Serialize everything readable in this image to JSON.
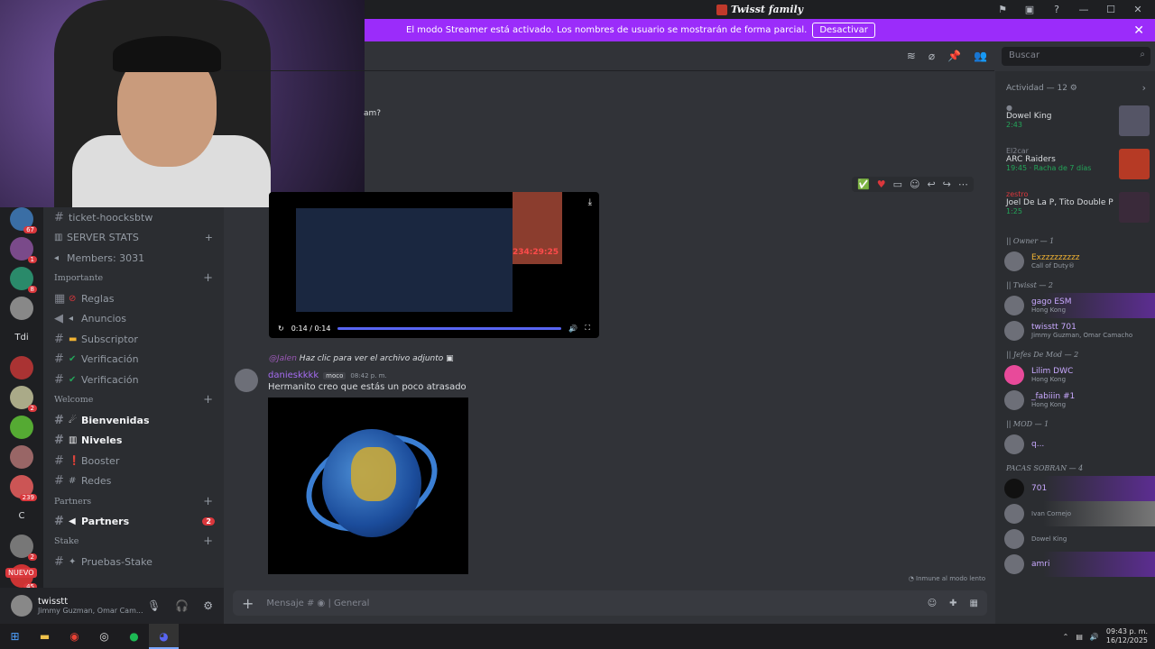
{
  "window": {
    "title": "Twisst family"
  },
  "banner": {
    "text": "El modo Streamer está activado. Los nombres de usuario se mostrarán de forma parcial.",
    "button": "Desactivar"
  },
  "search": {
    "placeholder": "Buscar"
  },
  "server_badges": [
    "67",
    "1",
    "8",
    "",
    "",
    "",
    "2",
    "",
    "",
    "239",
    "",
    "2",
    "45",
    "10"
  ],
  "server_letters": {
    "tdi": "Tdi",
    "c": "C"
  },
  "nuevo": "NUEVO",
  "channels": {
    "top": "ticket-hoocksbtw",
    "server_stats": {
      "title": "SERVER STATS",
      "members": "Members: 3031"
    },
    "importante": {
      "title": "Importante",
      "items": [
        "Reglas",
        "Anuncios",
        "Subscriptor",
        "Verificación",
        "Verificación"
      ]
    },
    "welcome": {
      "title": "Welcome",
      "items": [
        "Bienvenidas",
        "Niveles",
        "Booster",
        "Redes"
      ]
    },
    "partners": {
      "title": "Partners",
      "item": "Partners",
      "badge": "2"
    },
    "stake": {
      "title": "Stake",
      "item": "Pruebas-Stake"
    }
  },
  "user_panel": {
    "name": "twisstt",
    "status": "Jimmy Guzman, Omar Cam..."
  },
  "chat": {
    "video_time": "0:14 / 0:14",
    "video_overlay": "234:29:25",
    "clipped_text": "am?",
    "reply": {
      "name": "@Jalen",
      "text": "Haz clic para ver el archivo adjunto"
    },
    "message": {
      "user": "danieskkkk",
      "tag": "moco",
      "time": "08:42 p. m.",
      "text": "Hermanito creo que estás un poco atrasado"
    },
    "slow_mode": "Inmune al modo lento"
  },
  "composer": {
    "placeholder": "Mensaje #",
    "channel": "General"
  },
  "members": {
    "activity_header": "Actividad — 12",
    "activities": [
      {
        "name": "Dowel King",
        "sub": "2:43"
      },
      {
        "pre": "El2car",
        "name": "ARC Raiders",
        "sub": "19:45 · Racha de 7 días"
      },
      {
        "pre": "zestro",
        "name": "Joel De La P, Tito Double P",
        "sub": "1:25"
      }
    ],
    "groups": [
      {
        "role": "|| Owner — 1",
        "members": [
          {
            "n": "Exzzzzzzzzz",
            "s": "Call of Duty®"
          }
        ]
      },
      {
        "role": "|| Twisst — 2",
        "members": [
          {
            "n": "gago  ESM",
            "s": "Hong Kong"
          },
          {
            "n": "twisstt  701",
            "s": "Jimmy Guzman, Omar Camacho"
          }
        ]
      },
      {
        "role": "|| Jefes De Mod — 2",
        "members": [
          {
            "n": "Lilim  DWC",
            "s": "Hong Kong"
          },
          {
            "n": "_fabiiin  #1",
            "s": "Hong Kong"
          }
        ]
      },
      {
        "role": "|| MOD — 1",
        "members": [
          {
            "n": "q...",
            "s": ""
          }
        ]
      },
      {
        "role": "PACAS SOBRAN — 4",
        "members": [
          {
            "n": "701",
            "s": ""
          },
          {
            "n": "",
            "s": "Ivan Cornejo"
          },
          {
            "n": "",
            "s": "Dowel King"
          },
          {
            "n": "amri",
            "s": ""
          }
        ]
      }
    ]
  },
  "taskbar": {
    "time": "09:43 p. m.",
    "date": "16/12/2025"
  }
}
